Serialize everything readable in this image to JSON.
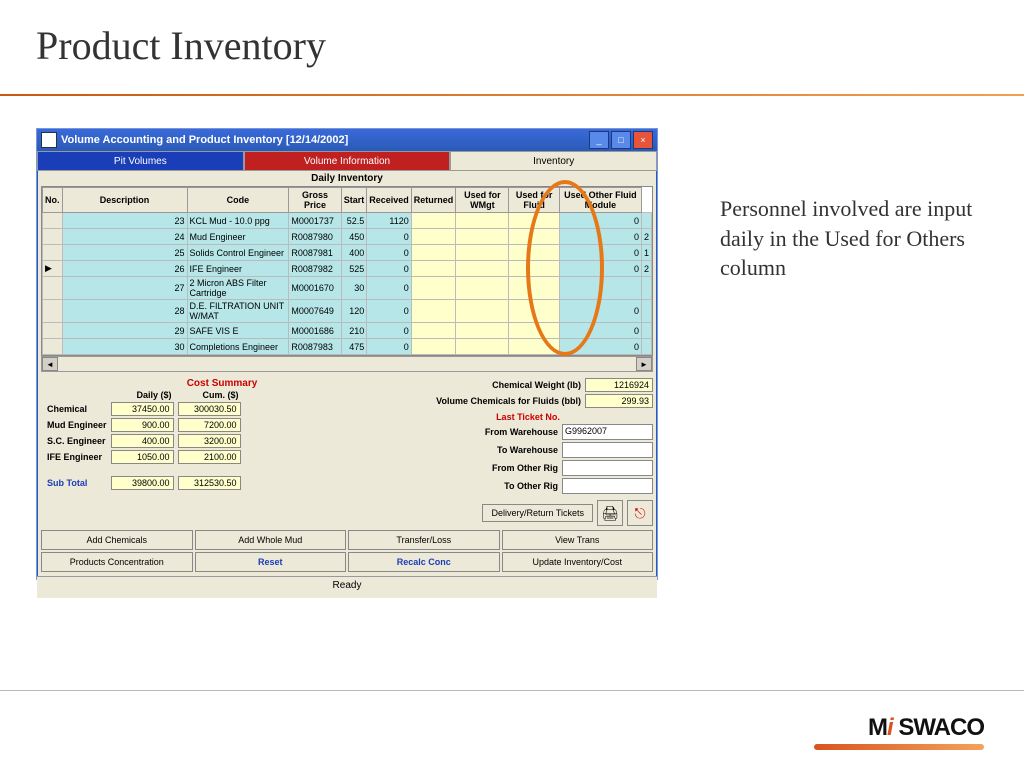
{
  "slide": {
    "title": "Product Inventory",
    "sideText": "Personnel involved are input daily in the Used for Others column",
    "logo": "Mi SWACO"
  },
  "window": {
    "title": "Volume Accounting and Product Inventory [12/14/2002]",
    "tabs": {
      "a": "Pit Volumes",
      "b": "Volume Information",
      "c": "Inventory"
    },
    "tableTitle": "Daily Inventory",
    "columns": [
      "No.",
      "Description",
      "Code",
      "Gross Price",
      "Start",
      "Received",
      "Returned",
      "Used for WMgt",
      "Used for Fluid",
      "Used Other Fluid Module"
    ],
    "rows": [
      {
        "no": "23",
        "desc": "KCL Mud - 10.0 ppg",
        "code": "M0001737",
        "gross": "52.5",
        "start": "1120",
        "received": "",
        "returned": "",
        "wmgt": "",
        "fluid": "0",
        "other": ""
      },
      {
        "no": "24",
        "desc": "Mud Engineer",
        "code": "R0087980",
        "gross": "450",
        "start": "0",
        "received": "",
        "returned": "",
        "wmgt": "",
        "fluid": "0",
        "other": "2"
      },
      {
        "no": "25",
        "desc": "Solids Control Engineer",
        "code": "R0087981",
        "gross": "400",
        "start": "0",
        "received": "",
        "returned": "",
        "wmgt": "",
        "fluid": "0",
        "other": "1"
      },
      {
        "no": "26",
        "desc": "IFE Engineer",
        "code": "R0087982",
        "gross": "525",
        "start": "0",
        "received": "",
        "returned": "",
        "wmgt": "",
        "fluid": "0",
        "other": "2"
      },
      {
        "no": "27",
        "desc": "2 Micron ABS Filter Cartridge",
        "code": "M0001670",
        "gross": "30",
        "start": "0",
        "received": "",
        "returned": "",
        "wmgt": "",
        "fluid": "",
        "other": ""
      },
      {
        "no": "28",
        "desc": "D.E. FILTRATION UNIT W/MAT",
        "code": "M0007649",
        "gross": "120",
        "start": "0",
        "received": "",
        "returned": "",
        "wmgt": "",
        "fluid": "0",
        "other": ""
      },
      {
        "no": "29",
        "desc": "SAFE VIS E",
        "code": "M0001686",
        "gross": "210",
        "start": "0",
        "received": "",
        "returned": "",
        "wmgt": "",
        "fluid": "0",
        "other": ""
      },
      {
        "no": "30",
        "desc": "Completions Engineer",
        "code": "R0087983",
        "gross": "475",
        "start": "0",
        "received": "",
        "returned": "",
        "wmgt": "",
        "fluid": "0",
        "other": ""
      }
    ],
    "cost": {
      "title": "Cost Summary",
      "headers": {
        "daily": "Daily ($)",
        "cum": "Cum. ($)"
      },
      "rows": [
        {
          "label": "Chemical",
          "daily": "37450.00",
          "cum": "300030.50"
        },
        {
          "label": "Mud Engineer",
          "daily": "900.00",
          "cum": "7200.00"
        },
        {
          "label": "S.C. Engineer",
          "daily": "400.00",
          "cum": "3200.00"
        },
        {
          "label": "IFE Engineer",
          "daily": "1050.00",
          "cum": "2100.00"
        }
      ],
      "subtotalLabel": "Sub Total",
      "subtotal": {
        "daily": "39800.00",
        "cum": "312530.50"
      }
    },
    "right": {
      "chemWeightLabel": "Chemical Weight (lb)",
      "chemWeight": "1216924",
      "volChemLabel": "Volume Chemicals for Fluids (bbl)",
      "volChem": "299.93",
      "ticketTitle": "Last Ticket No.",
      "fromWhLabel": "From Warehouse",
      "fromWh": "G9962007",
      "toWhLabel": "To Warehouse",
      "toWh": "",
      "fromRigLabel": "From Other Rig",
      "fromRig": "",
      "toRigLabel": "To Other Rig",
      "toRig": "",
      "deliveryBtn": "Delivery/Return Tickets"
    },
    "bottomButtons": {
      "addChem": "Add Chemicals",
      "addMud": "Add Whole Mud",
      "transfer": "Transfer/Loss",
      "viewTrans": "View Trans",
      "prodConc": "Products Concentration",
      "reset": "Reset",
      "recalc": "Recalc Conc",
      "update": "Update Inventory/Cost"
    },
    "status": "Ready"
  }
}
